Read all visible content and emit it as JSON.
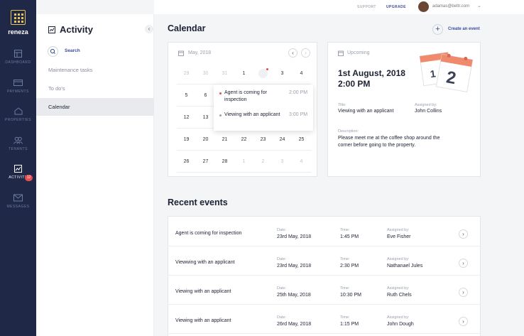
{
  "brand": {
    "name": "reneza"
  },
  "nav": [
    {
      "label": "DASHBOARD",
      "icon": "dashboard-icon"
    },
    {
      "label": "PAYMENTS",
      "icon": "payments-icon"
    },
    {
      "label": "PROPERTIES",
      "icon": "properties-icon"
    },
    {
      "label": "TENANTS",
      "icon": "tenants-icon"
    },
    {
      "label": "ACTIVITY",
      "icon": "activity-icon",
      "badge": "12",
      "active": true
    },
    {
      "label": "MESSAGES",
      "icon": "messages-icon"
    }
  ],
  "topbar": {
    "support": "SUPPORT",
    "upgrade": "UPGRADE",
    "email": "adamas@bettr.com"
  },
  "panel": {
    "title": "Activity",
    "search_label": "Search",
    "items": [
      "Maintenance tasks",
      "To do's",
      "Calendar"
    ],
    "selected": "Calendar"
  },
  "main": {
    "calendar_title": "Calendar",
    "create_label": "Create an event"
  },
  "calendar": {
    "month": "May, 2018",
    "weeks": [
      [
        "29",
        "30",
        "31",
        "1",
        "2",
        "3",
        "4"
      ],
      [
        "5",
        "6",
        "7",
        "8",
        "9",
        "10",
        "11"
      ],
      [
        "12",
        "13",
        "14",
        "15",
        "16",
        "17",
        "18"
      ],
      [
        "19",
        "20",
        "21",
        "22",
        "23",
        "24",
        "25"
      ],
      [
        "26",
        "27",
        "28",
        "1",
        "2",
        "3",
        "4"
      ]
    ],
    "selected_day": "2",
    "popup_events": [
      {
        "title": "Agent is coming for inspection",
        "time": "2:00 PM",
        "color": "#e84d4d"
      },
      {
        "title": "Viewing with an applicant",
        "time": "3:00 PM",
        "color": "#9aa0ac"
      }
    ]
  },
  "upcoming": {
    "label": "Upcoming",
    "date_line1": "1st August, 2018",
    "date_line2": "2:00 PM",
    "title_label": "Title:",
    "title_value": "Viewing with an applicant",
    "assigned_label": "Assigned by:",
    "assigned_value": "John Collins",
    "desc_label": "Description:",
    "desc_line1": "Please meet me at the coffee shop around the",
    "desc_line2": "corner before going to the property.",
    "illustration_day": "2",
    "illustration_prev": "1"
  },
  "recent": {
    "title": "Recent events",
    "date_label": "Date:",
    "time_label": "Time:",
    "assigned_label": "Assigned by:",
    "rows": [
      {
        "title": "Agent is coming for inspection",
        "date": "23rd May, 2018",
        "time": "1:45 PM",
        "assigned": "Eve Fisher"
      },
      {
        "title": "Viewwing with an applicant",
        "date": "23rd May, 2018",
        "time": "2:30 PM",
        "assigned": "Nathanael Jules"
      },
      {
        "title": "Viewing with an applicant",
        "date": "25th May, 2018",
        "time": "10:30 PM",
        "assigned": "Ruth Chels"
      },
      {
        "title": "Viewing with an applicant",
        "date": "26rd May, 2018",
        "time": "1:15 PM",
        "assigned": "John Dough"
      }
    ]
  },
  "colors": {
    "rail": "#1f2947",
    "accent": "#3a4b9a",
    "brand": "#e8c35a",
    "alert": "#e84d4d"
  }
}
